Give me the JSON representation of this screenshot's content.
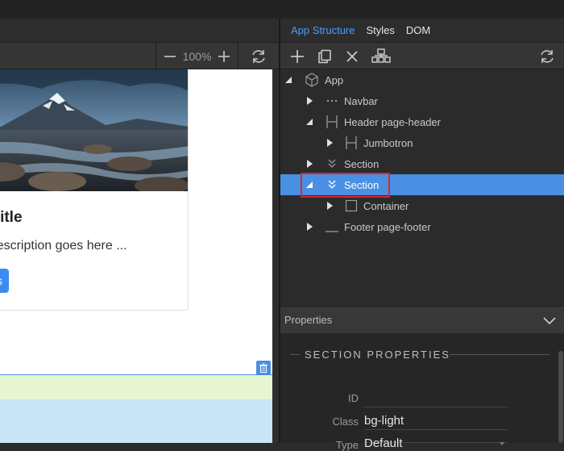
{
  "canvas": {
    "zoom": "100%",
    "card": {
      "title": "ect title",
      "description": "ect description goes here ...",
      "button": "Details"
    }
  },
  "panel": {
    "tabs": [
      "App Structure",
      "Styles",
      "DOM"
    ],
    "active_tab": "App Structure",
    "tree": [
      {
        "label": "App",
        "icon": "cube-icon",
        "expanded": true
      },
      {
        "label": "Navbar",
        "icon": "dots-icon",
        "expanded": false
      },
      {
        "label": "Header page-header",
        "icon": "h-icon",
        "expanded": true
      },
      {
        "label": "Jumbotron",
        "icon": "h-icon",
        "expanded": false
      },
      {
        "label": "Section",
        "icon": "chevrons-down-icon",
        "expanded": false
      },
      {
        "label": "Section",
        "icon": "chevrons-down-icon",
        "expanded": true,
        "selected": true
      },
      {
        "label": "Container",
        "icon": "square-icon",
        "expanded": false
      },
      {
        "label": "Footer page-footer",
        "icon": "underscore-icon",
        "expanded": false
      }
    ],
    "properties": {
      "header": "Properties",
      "section_title": "SECTION PROPERTIES",
      "id_label": "ID",
      "id_value": "",
      "class_label": "Class",
      "class_value": "bg-light",
      "type_label": "Type",
      "type_value": "Default"
    }
  },
  "colors": {
    "accent": "#4a90e2",
    "highlight": "#e0242b",
    "tab_active": "#4a9eff"
  }
}
